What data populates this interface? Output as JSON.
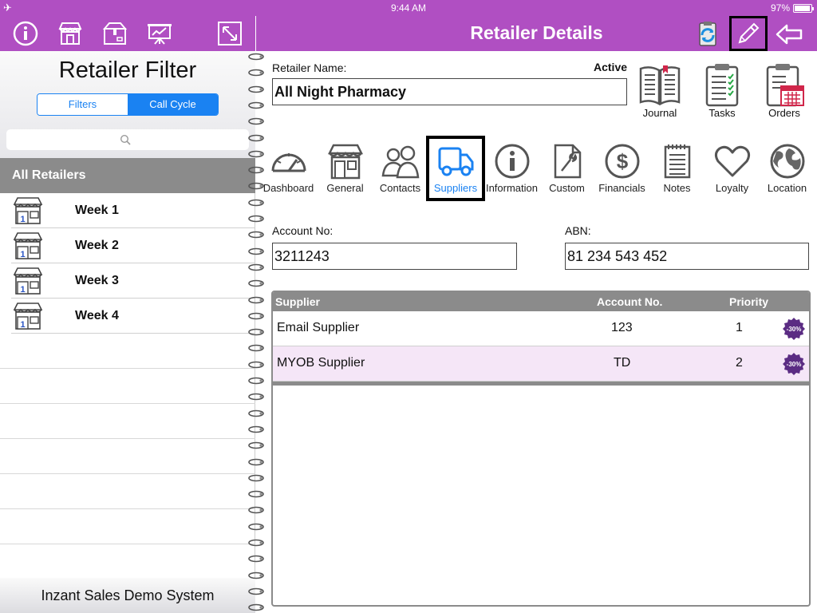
{
  "status_bar": {
    "time": "9:44 AM",
    "battery": "97%",
    "airplane_icon": "airplane-icon"
  },
  "left_panel": {
    "toolbar_icons": [
      "info-icon",
      "store-icon",
      "package-icon",
      "presentation-icon",
      "expand-icon"
    ],
    "title": "Retailer Filter",
    "segments": [
      {
        "label": "Filters",
        "active": false
      },
      {
        "label": "Call Cycle",
        "active": true
      }
    ],
    "search": {
      "placeholder": ""
    },
    "all_retailers": "All Retailers",
    "weeks": [
      {
        "label": "Week 1",
        "badge": "1"
      },
      {
        "label": "Week 2",
        "badge": "1"
      },
      {
        "label": "Week 3",
        "badge": "1"
      },
      {
        "label": "Week 4",
        "badge": "1"
      }
    ],
    "footer": "Inzant Sales Demo System"
  },
  "right_panel": {
    "title": "Retailer Details",
    "toolbar_icons": [
      "sync-icon",
      "edit-pencil-icon",
      "back-arrow-icon"
    ],
    "retailer_name_label": "Retailer Name:",
    "retailer_name": "All Night Pharmacy",
    "status": "Active",
    "quick_actions": [
      {
        "label": "Journal",
        "icon": "journal-icon"
      },
      {
        "label": "Tasks",
        "icon": "tasks-clipboard-icon"
      },
      {
        "label": "Orders",
        "icon": "orders-calendar-icon"
      }
    ],
    "tabs": [
      {
        "label": "Dashboard",
        "icon": "dashboard-gauge-icon"
      },
      {
        "label": "General",
        "icon": "store-icon"
      },
      {
        "label": "Contacts",
        "icon": "contacts-people-icon"
      },
      {
        "label": "Suppliers",
        "icon": "truck-icon",
        "selected": true
      },
      {
        "label": "Information",
        "icon": "info-icon"
      },
      {
        "label": "Custom",
        "icon": "custom-wrench-icon"
      },
      {
        "label": "Financials",
        "icon": "dollar-icon"
      },
      {
        "label": "Notes",
        "icon": "notes-icon"
      },
      {
        "label": "Loyalty",
        "icon": "heart-icon"
      },
      {
        "label": "Location",
        "icon": "globe-icon"
      }
    ],
    "account_no_label": "Account No:",
    "account_no": "3211243",
    "abn_label": "ABN:",
    "abn": "81 234 543 452",
    "supplier_table": {
      "headers": {
        "supplier": "Supplier",
        "account_no": "Account No.",
        "priority": "Priority"
      },
      "rows": [
        {
          "supplier": "Email Supplier",
          "account_no": "123",
          "priority": "1",
          "badge": "-30%"
        },
        {
          "supplier": "MYOB Supplier",
          "account_no": "TD",
          "priority": "2",
          "badge": "-30%"
        }
      ]
    },
    "colors": {
      "toolbar": "#b04fc2",
      "accent_blue": "#1a82f2",
      "header_gray": "#8b8b8b",
      "alt_row": "#f5e6f7",
      "badge_purple": "#5b2c83"
    }
  }
}
